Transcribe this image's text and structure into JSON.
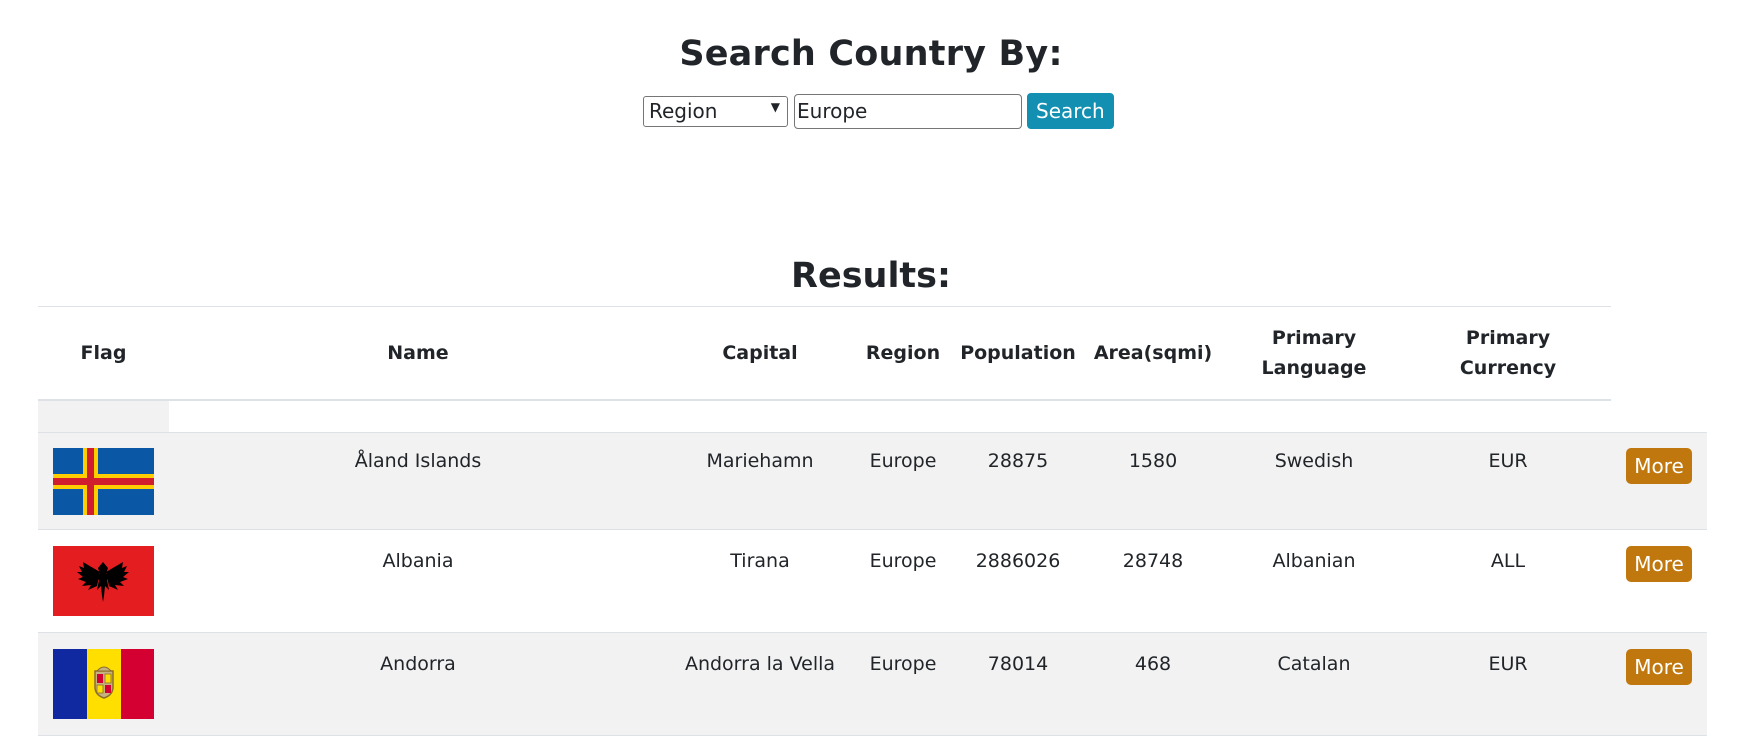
{
  "search": {
    "title": "Search Country By:",
    "filter_selected": "Region",
    "query_value": "Europe",
    "button_label": "Search"
  },
  "results": {
    "title": "Results:",
    "columns": [
      "Flag",
      "Name",
      "Capital",
      "Region",
      "Population",
      "Area(sqmi)",
      "Primary Language",
      "Primary Currency"
    ],
    "more_label": "More",
    "rows": [
      {
        "name": "Åland Islands",
        "capital": "Mariehamn",
        "region": "Europe",
        "population": "28875",
        "area": "1580",
        "language": "Swedish",
        "currency": "EUR",
        "flag": "flag-aland-icon"
      },
      {
        "name": "Albania",
        "capital": "Tirana",
        "region": "Europe",
        "population": "2886026",
        "area": "28748",
        "language": "Albanian",
        "currency": "ALL",
        "flag": "flag-albania-icon"
      },
      {
        "name": "Andorra",
        "capital": "Andorra la Vella",
        "region": "Europe",
        "population": "78014",
        "area": "468",
        "language": "Catalan",
        "currency": "EUR",
        "flag": "flag-andorra-icon"
      }
    ]
  },
  "colors": {
    "search_button": "#138fb2",
    "more_button": "#c0770e",
    "striped_row": "#f2f2f2"
  }
}
